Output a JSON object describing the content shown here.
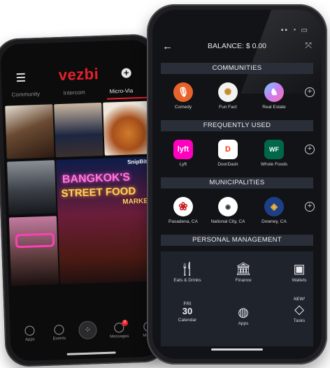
{
  "back_phone": {
    "logo": "vezbi",
    "tabs": [
      "Community",
      "Intercom",
      "Micro-Via"
    ],
    "overlay_snip": "SnipBit",
    "street_food_1": "BANGKOK'S",
    "street_food_2": "STREET FOOD",
    "street_food_3": "MARKET",
    "nav": [
      "Apps",
      "Events",
      "Messages",
      "Merch"
    ],
    "messages_badge": "0",
    "accent_color": "#e8202a"
  },
  "front_phone": {
    "header": {
      "balance": "BALANCE: $ 0.00"
    },
    "sections": {
      "communities": "COMMUNITIES",
      "frequently_used": "FREQUENTLY USED",
      "municipalities": "MUNICIPALITIES",
      "personal_management": "PERSONAL MANAGEMENT"
    },
    "communities": [
      {
        "label": "Comedy",
        "icon": "microphone-icon",
        "color": "#e8632c"
      },
      {
        "label": "Fun Fact",
        "icon": "brain-icon",
        "color": "#f2f2f2"
      },
      {
        "label": "Real Estate",
        "icon": "unicorn-icon",
        "color": "#c97cf0"
      }
    ],
    "frequently_used": [
      {
        "label": "Lyft",
        "icon": "lyft-logo",
        "mark": "lyft",
        "color": "#ff00bf"
      },
      {
        "label": "DoorDash",
        "icon": "doordash-logo",
        "mark": "D",
        "color": "#ff3008"
      },
      {
        "label": "Whole Foods",
        "icon": "whole-foods-logo",
        "mark": "WF",
        "color": "#00674b"
      }
    ],
    "municipalities": [
      {
        "label": "Pasadena, CA",
        "icon": "rose-icon",
        "color": "#c81e24"
      },
      {
        "label": "National City, CA",
        "icon": "national-city-seal-icon",
        "color": "#ffffff"
      },
      {
        "label": "Downey, CA",
        "icon": "downey-seal-icon",
        "color": "#1d3f86"
      }
    ],
    "personal_management": [
      {
        "label": "Eats & Drinks",
        "icon": "fork-knife-icon"
      },
      {
        "label": "Finance",
        "icon": "bank-icon"
      },
      {
        "label": "Wallets",
        "icon": "wallet-icon"
      },
      {
        "label": "Calendar",
        "icon": "calendar-icon",
        "day": "FRI",
        "date": "30"
      },
      {
        "label": "Apps",
        "icon": "globe-icon"
      },
      {
        "label": "Tasks",
        "icon": "layers-icon",
        "tag": "NEW!"
      }
    ]
  }
}
